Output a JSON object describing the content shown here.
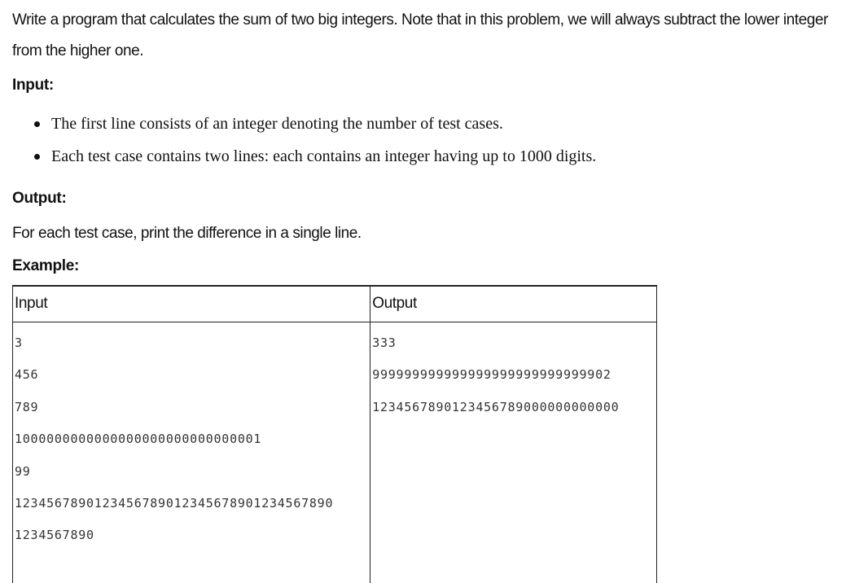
{
  "problem": {
    "statement": "Write a program that calculates the sum of two big integers. Note that in this problem, we will always subtract the lower integer from the higher one.",
    "input_heading": "Input:",
    "input_bullets": [
      "The first line consists of an integer denoting the number of test cases.",
      "Each test case contains two lines: each contains an integer having up to 1000 digits."
    ],
    "output_heading": "Output:",
    "output_text": "For each test case, print the difference in a single line.",
    "example_heading": "Example:"
  },
  "example_table": {
    "headers": [
      "Input",
      "Output"
    ],
    "input_lines": [
      "3",
      "456",
      "789",
      "1000000000000000000000000000001",
      "99",
      "1234567890123456789012345678901234567890",
      "1234567890"
    ],
    "output_lines": [
      "333",
      "999999999999999999999999999902",
      "1234567890123456789000000000000"
    ]
  }
}
